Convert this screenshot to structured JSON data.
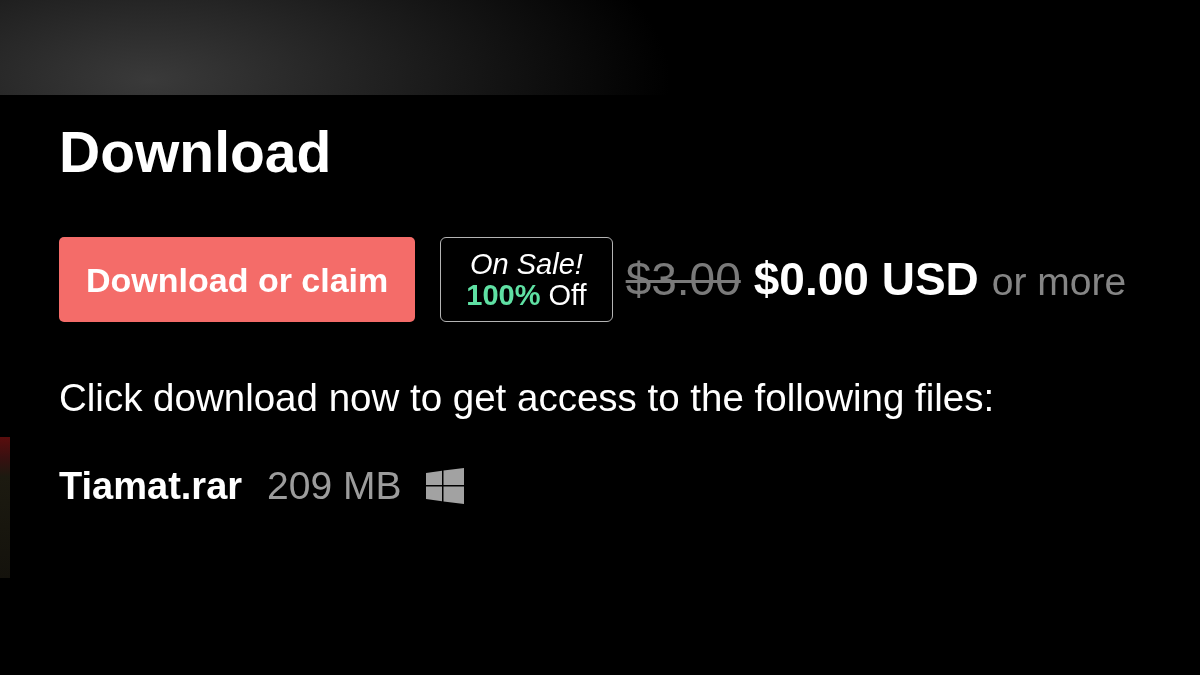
{
  "section": {
    "title": "Download"
  },
  "buy_button": {
    "label": "Download or claim"
  },
  "sale_badge": {
    "headline": "On Sale!",
    "discount": "100%",
    "discount_suffix": "Off"
  },
  "price": {
    "original": "$3.00",
    "current": "$0.00 USD",
    "suffix": "or more"
  },
  "instructions": "Click download now to get access to the following files:",
  "files": [
    {
      "name": "Tiamat.rar",
      "size": "209 MB"
    }
  ]
}
